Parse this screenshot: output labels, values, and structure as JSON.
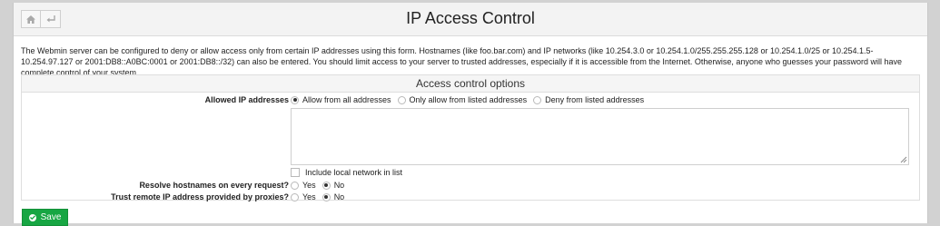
{
  "header": {
    "title": "IP Access Control",
    "home_icon": "home-icon",
    "back_icon": "back-arrow-icon"
  },
  "description": "The Webmin server can be configured to deny or allow access only from certain IP addresses using this form. Hostnames (like foo.bar.com) and IP networks (like 10.254.3.0 or 10.254.1.0/255.255.255.128 or 10.254.1.0/25 or 10.254.1.5-10.254.97.127 or 2001:DB8::A0BC:0001 or 2001:DB8::/32) can also be entered. You should limit access to your server to trusted addresses, especially if it is accessible from the Internet. Otherwise, anyone who guesses your password will have complete control of your system.",
  "section": {
    "title": "Access control options",
    "allowed_ip": {
      "label": "Allowed IP addresses",
      "options": [
        "Allow from all addresses",
        "Only allow from listed addresses",
        "Deny from listed addresses"
      ],
      "selected": 0,
      "textarea_value": "",
      "include_local_label": "Include local network in list",
      "include_local_checked": false
    },
    "resolve_hostnames": {
      "label": "Resolve hostnames on every request?",
      "yes": "Yes",
      "no": "No",
      "selected": "No"
    },
    "trust_proxies": {
      "label": "Trust remote IP address provided by proxies?",
      "yes": "Yes",
      "no": "No",
      "selected": "No"
    }
  },
  "actions": {
    "save_label": "Save",
    "save_icon": "check-circle-icon"
  },
  "colors": {
    "save_button": "#17a643",
    "topbar": "#f3f3f3",
    "page_background": "#d2d2d2"
  }
}
